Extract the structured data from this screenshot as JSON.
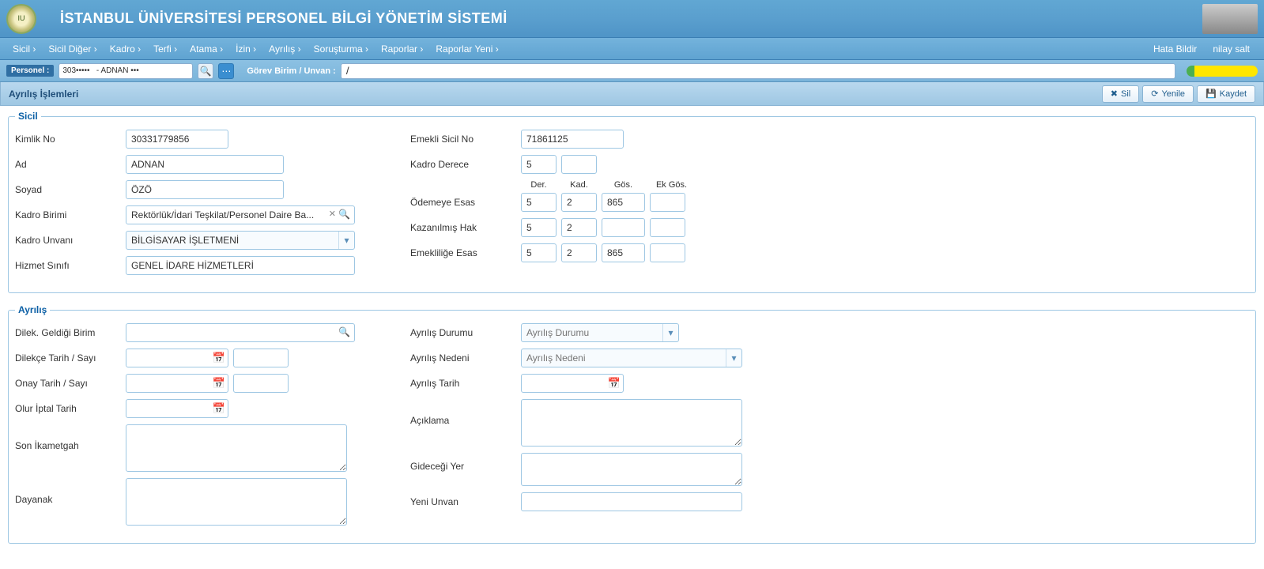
{
  "header": {
    "title": "İSTANBUL ÜNİVERSİTESİ PERSONEL BİLGİ YÖNETİM SİSTEMİ"
  },
  "menu": {
    "items": [
      "Sicil",
      "Sicil Diğer",
      "Kadro",
      "Terfi",
      "Atama",
      "İzin",
      "Ayrılış",
      "Soruşturma",
      "Raporlar",
      "Raporlar Yeni"
    ],
    "hata_bildir": "Hata Bildir",
    "user": "nilay salt"
  },
  "searchbar": {
    "personel_label": "Personel :",
    "personel_value": "303•••••   - ADNAN •••",
    "gorev_label": "Görev Birim / Unvan :",
    "gorev_value": "/"
  },
  "panel": {
    "title": "Ayrılış İşlemleri",
    "sil": "Sil",
    "yenile": "Yenile",
    "kaydet": "Kaydet"
  },
  "sicil": {
    "legend": "Sicil",
    "labels": {
      "kimlik_no": "Kimlik No",
      "ad": "Ad",
      "soyad": "Soyad",
      "kadro_birimi": "Kadro Birimi",
      "kadro_unvani": "Kadro Unvanı",
      "hizmet_sinifi": "Hizmet Sınıfı",
      "emekli_sicil_no": "Emekli Sicil No",
      "kadro_derece": "Kadro Derece",
      "odemeye_esas": "Ödemeye Esas",
      "kazanilmis_hak": "Kazanılmış Hak",
      "emeklilige_esas": "Emekliliğe Esas",
      "der": "Der.",
      "kad": "Kad.",
      "gos": "Gös.",
      "ekgos": "Ek Gös."
    },
    "values": {
      "kimlik_no": "30331779856",
      "ad": "ADNAN",
      "soyad": "ÖZÖ",
      "kadro_birimi": "Rektörlük/İdari Teşkilat/Personel Daire Ba...",
      "kadro_unvani": "BİLGİSAYAR İŞLETMENİ",
      "hizmet_sinifi": "GENEL İDARE HİZMETLERİ",
      "emekli_sicil_no": "71861125",
      "kadro_derece_1": "5",
      "kadro_derece_2": "",
      "odemeye": {
        "der": "5",
        "kad": "2",
        "gos": "865",
        "ekgos": ""
      },
      "kazanilmis": {
        "der": "5",
        "kad": "2",
        "gos": "",
        "ekgos": ""
      },
      "emeklilik": {
        "der": "5",
        "kad": "2",
        "gos": "865",
        "ekgos": ""
      }
    }
  },
  "ayrilis": {
    "legend": "Ayrılış",
    "labels": {
      "dilek_birim": "Dilek. Geldiği Birim",
      "dilekce_tarih": "Dilekçe Tarih / Sayı",
      "onay_tarih": "Onay Tarih / Sayı",
      "olur_iptal": "Olur İptal Tarih",
      "son_ikametgah": "Son İkametgah",
      "dayanak": "Dayanak",
      "ayrilis_durumu": "Ayrılış Durumu",
      "ayrilis_nedeni": "Ayrılış Nedeni",
      "ayrilis_tarih": "Ayrılış Tarih",
      "aciklama": "Açıklama",
      "gidecegi_yer": "Gideceği Yer",
      "yeni_unvan": "Yeni Unvan"
    },
    "placeholders": {
      "ayrilis_durumu": "Ayrılış Durumu",
      "ayrilis_nedeni": "Ayrılış Nedeni"
    }
  }
}
